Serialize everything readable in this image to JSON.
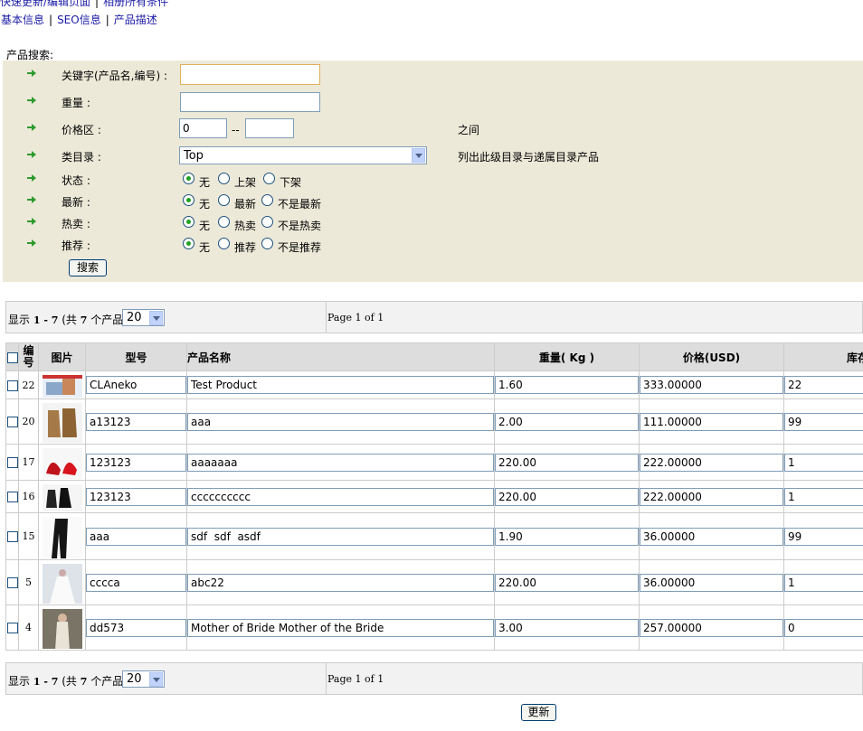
{
  "top_links": [
    "快速更新/编辑页面",
    "相册所有条件"
  ],
  "tabs": [
    "基本信息",
    "SEO信息",
    "产品描述"
  ],
  "search": {
    "title": "产品搜索:",
    "keyword_label": "关键字(产品名,编号) :",
    "keyword_value": "",
    "weight_label": "重量 :",
    "weight_value": "",
    "price_label": "价格区 :",
    "price_min": "0",
    "price_max": "",
    "price_sep": "--",
    "price_hint": "之间",
    "category_label": "类目录 :",
    "category_value": "Top",
    "category_hint": "列出此级目录与递属目录产品",
    "status_label": "状态 :",
    "status_options": [
      "无",
      "上架",
      "下架"
    ],
    "newest_label": "最新 :",
    "newest_options": [
      "无",
      "最新",
      "不是最新"
    ],
    "hot_label": "热卖 :",
    "hot_options": [
      "无",
      "热卖",
      "不是热卖"
    ],
    "recommend_label": "推荐 :",
    "recommend_options": [
      "无",
      "推荐",
      "不是推荐"
    ],
    "search_button": "搜索"
  },
  "pager": {
    "shown_prefix": "显示",
    "shown_range": "1 - 7",
    "shown_suffix_a": "(共",
    "shown_total": "7",
    "shown_suffix_b": "个产品)",
    "page_size": "20",
    "page_text": "Page 1 of 1"
  },
  "table": {
    "headers": {
      "id": "编号",
      "image": "图片",
      "model": "型号",
      "name": "产品名称",
      "weight": "重量( Kg )",
      "price": "价格(USD)",
      "stock": "库存"
    },
    "rows": [
      {
        "id": "22",
        "model": "CLAneko",
        "name": "Test Product",
        "weight": "1.60",
        "price": "333.00000",
        "stock": "22"
      },
      {
        "id": "20",
        "model": "a13123",
        "name": "aaa",
        "weight": "2.00",
        "price": "111.00000",
        "stock": "99"
      },
      {
        "id": "17",
        "model": "123123",
        "name": "aaaaaaa",
        "weight": "220.00",
        "price": "222.00000",
        "stock": "1"
      },
      {
        "id": "16",
        "model": "123123",
        "name": "cccccccccc",
        "weight": "220.00",
        "price": "222.00000",
        "stock": "1"
      },
      {
        "id": "15",
        "model": "aaa",
        "name": "sdf  sdf  asdf",
        "weight": "1.90",
        "price": "36.00000",
        "stock": "99"
      },
      {
        "id": "5",
        "model": "cccca",
        "name": "abc22",
        "weight": "220.00",
        "price": "36.00000",
        "stock": "1"
      },
      {
        "id": "4",
        "model": "dd573",
        "name": "Mother of Bride Mother of the Bride",
        "weight": "3.00",
        "price": "257.00000",
        "stock": "0"
      }
    ]
  },
  "update_button": "更新",
  "colors": {
    "panel_bg": "#ece9d8",
    "arrow": "#2e9a2e",
    "radio_on": "#21a121"
  }
}
